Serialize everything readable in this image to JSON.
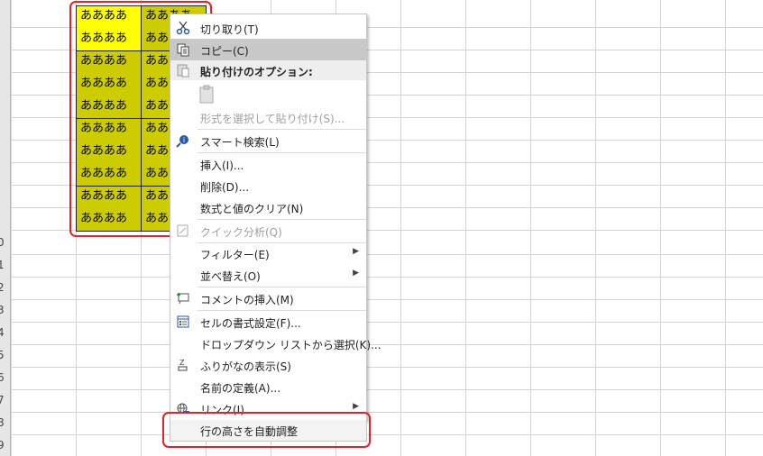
{
  "row_numbers": [
    "0",
    "1",
    "2",
    "3",
    "4",
    "5",
    "6",
    "7",
    "8",
    "9"
  ],
  "cell_text": "あああああ",
  "cells_short": "ああああ",
  "context_menu": {
    "cut": "切り取り(T)",
    "copy": "コピー(C)",
    "paste_options": "貼り付けのオプション:",
    "paste_special": "形式を選択して貼り付け(S)...",
    "smart_lookup": "スマート検索(L)",
    "insert": "挿入(I)...",
    "delete": "削除(D)...",
    "clear_contents": "数式と値のクリア(N)",
    "quick_analysis": "クイック分析(Q)",
    "filter": "フィルター(E)",
    "sort": "並べ替え(O)",
    "insert_comment": "コメントの挿入(M)",
    "format_cells": "セルの書式設定(F)...",
    "pick_from_list": "ドロップダウン リストから選択(K)...",
    "show_phonetic": "ふりがなの表示(S)",
    "define_name": "名前の定義(A)...",
    "link": "リンク(I)",
    "autofit_row_height": "行の高さを自動調整"
  },
  "colors": {
    "highlight_red": "#e8202a",
    "cell_yellow": "#ffff00",
    "cell_olive": "#cccc00"
  }
}
